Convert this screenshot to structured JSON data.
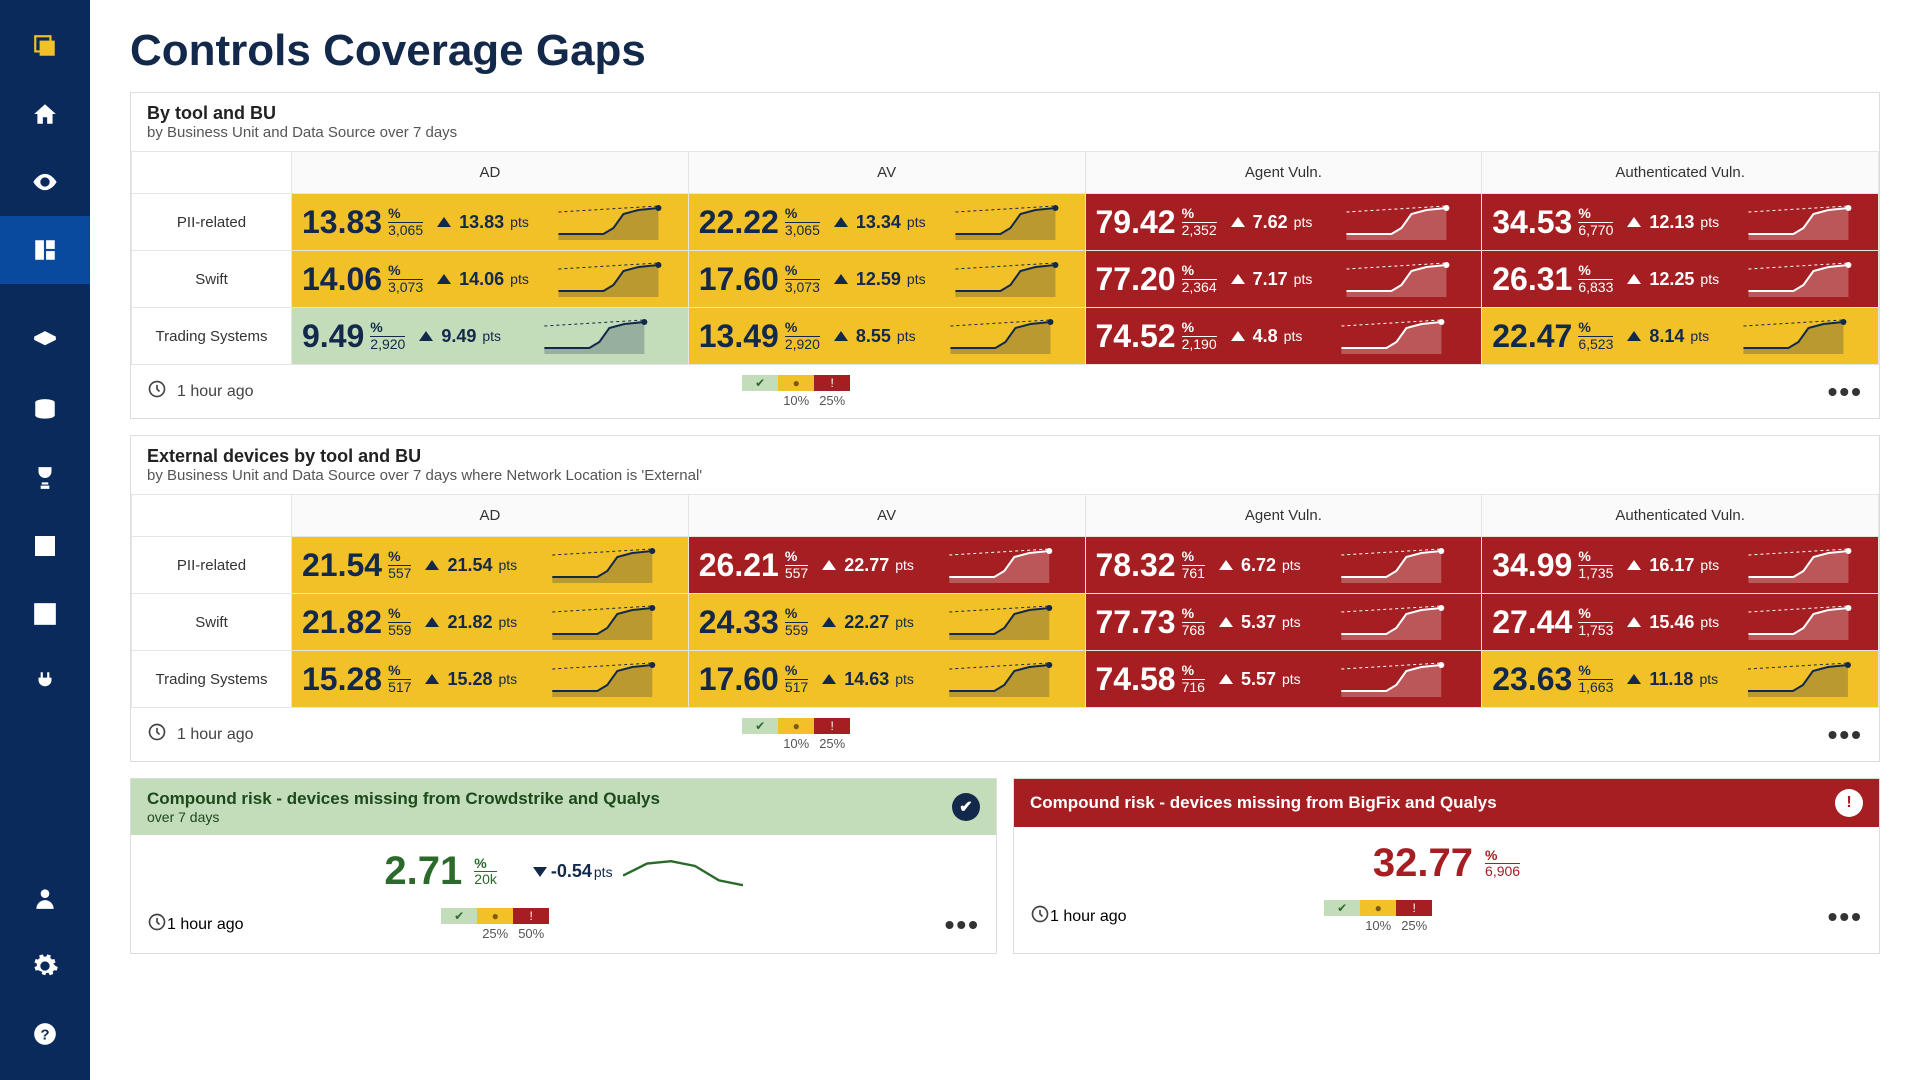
{
  "page_title": "Controls Coverage Gaps",
  "sidebar_icons": [
    "logo",
    "home",
    "eye",
    "dashboard",
    "diamond",
    "database",
    "trophy",
    "calc",
    "check",
    "plug",
    "user",
    "gear",
    "help"
  ],
  "panels": {
    "p1": {
      "title": "By tool and BU",
      "subtitle": "by Business Unit and Data Source over 7 days",
      "columns": [
        "AD",
        "AV",
        "Agent Vuln.",
        "Authenticated Vuln."
      ],
      "row_labels": [
        "PII-related",
        "Swift",
        "Trading Systems"
      ],
      "cells": [
        [
          {
            "v": "13.83",
            "n": "3,065",
            "d": "13.83",
            "c": "yellow"
          },
          {
            "v": "22.22",
            "n": "3,065",
            "d": "13.34",
            "c": "yellow"
          },
          {
            "v": "79.42",
            "n": "2,352",
            "d": "7.62",
            "c": "red"
          },
          {
            "v": "34.53",
            "n": "6,770",
            "d": "12.13",
            "c": "red"
          }
        ],
        [
          {
            "v": "14.06",
            "n": "3,073",
            "d": "14.06",
            "c": "yellow"
          },
          {
            "v": "17.60",
            "n": "3,073",
            "d": "12.59",
            "c": "yellow"
          },
          {
            "v": "77.20",
            "n": "2,364",
            "d": "7.17",
            "c": "red"
          },
          {
            "v": "26.31",
            "n": "6,833",
            "d": "12.25",
            "c": "red"
          }
        ],
        [
          {
            "v": "9.49",
            "n": "2,920",
            "d": "9.49",
            "c": "green"
          },
          {
            "v": "13.49",
            "n": "2,920",
            "d": "8.55",
            "c": "yellow"
          },
          {
            "v": "74.52",
            "n": "2,190",
            "d": "4.8",
            "c": "red"
          },
          {
            "v": "22.47",
            "n": "6,523",
            "d": "8.14",
            "c": "yellow"
          }
        ]
      ],
      "legend": [
        "10%",
        "25%"
      ],
      "time": "1 hour ago"
    },
    "p2": {
      "title": "External devices by tool and BU",
      "subtitle": "by Business Unit and Data Source over 7 days where Network Location is 'External'",
      "columns": [
        "AD",
        "AV",
        "Agent Vuln.",
        "Authenticated Vuln."
      ],
      "row_labels": [
        "PII-related",
        "Swift",
        "Trading Systems"
      ],
      "cells": [
        [
          {
            "v": "21.54",
            "n": "557",
            "d": "21.54",
            "c": "yellow"
          },
          {
            "v": "26.21",
            "n": "557",
            "d": "22.77",
            "c": "red"
          },
          {
            "v": "78.32",
            "n": "761",
            "d": "6.72",
            "c": "red"
          },
          {
            "v": "34.99",
            "n": "1,735",
            "d": "16.17",
            "c": "red"
          }
        ],
        [
          {
            "v": "21.82",
            "n": "559",
            "d": "21.82",
            "c": "yellow"
          },
          {
            "v": "24.33",
            "n": "559",
            "d": "22.27",
            "c": "yellow"
          },
          {
            "v": "77.73",
            "n": "768",
            "d": "5.37",
            "c": "red"
          },
          {
            "v": "27.44",
            "n": "1,753",
            "d": "15.46",
            "c": "red"
          }
        ],
        [
          {
            "v": "15.28",
            "n": "517",
            "d": "15.28",
            "c": "yellow"
          },
          {
            "v": "17.60",
            "n": "517",
            "d": "14.63",
            "c": "yellow"
          },
          {
            "v": "74.58",
            "n": "716",
            "d": "5.57",
            "c": "red"
          },
          {
            "v": "23.63",
            "n": "1,663",
            "d": "11.18",
            "c": "yellow"
          }
        ]
      ],
      "legend": [
        "10%",
        "25%"
      ],
      "time": "1 hour ago"
    }
  },
  "bottom": {
    "left": {
      "title": "Compound risk - devices missing from Crowdstrike and Qualys",
      "sub": "over 7 days",
      "v": "2.71",
      "n": "20k",
      "d": "-0.54",
      "dir": "down",
      "legend": [
        "25%",
        "50%"
      ],
      "time": "1 hour ago"
    },
    "right": {
      "title": "Compound risk - devices missing from BigFix and Qualys",
      "v": "32.77",
      "n": "6,906",
      "legend": [
        "10%",
        "25%"
      ],
      "time": "1 hour ago"
    }
  },
  "units": {
    "pct": "%",
    "pts": "pts"
  }
}
